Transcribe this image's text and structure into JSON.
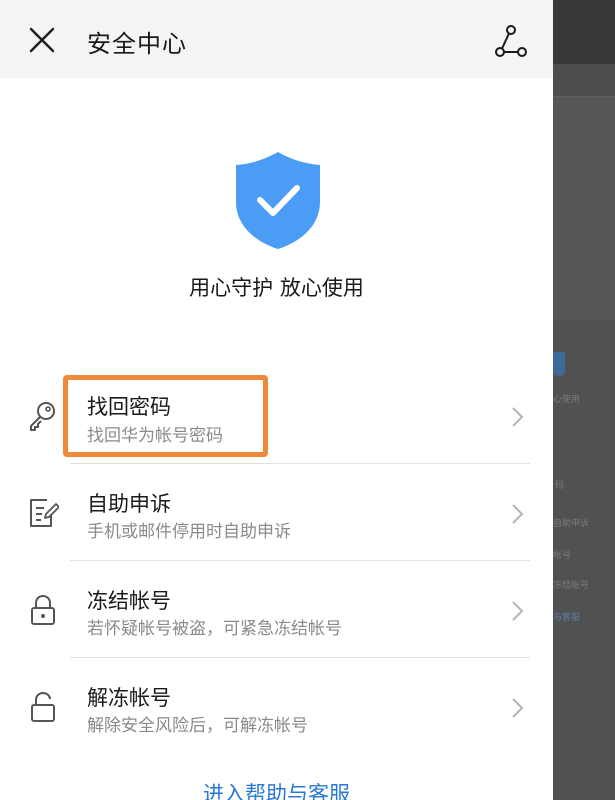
{
  "header": {
    "title": "安全中心",
    "close_icon": "close-icon",
    "share_icon": "share-icon"
  },
  "hero": {
    "shield_icon": "shield-check-icon",
    "shield_color": "#4a9cf5",
    "tagline": "用心守护 放心使用"
  },
  "menu": [
    {
      "icon": "key-icon",
      "title": "找回密码",
      "subtitle": "找回华为帐号密码",
      "highlighted": true
    },
    {
      "icon": "edit-note-icon",
      "title": "自助申诉",
      "subtitle": "手机或邮件停用时自助申诉"
    },
    {
      "icon": "lock-closed-icon",
      "title": "冻结帐号",
      "subtitle": "若怀疑帐号被盗，可紧急冻结帐号"
    },
    {
      "icon": "lock-open-icon",
      "title": "解冻帐号",
      "subtitle": "解除安全风险后，可解冻帐号"
    }
  ],
  "footer": {
    "help_link": "进入帮助与客服"
  },
  "colors": {
    "highlight": "#f0883a",
    "link": "#2878d6"
  },
  "background_page": {
    "fragment_1": "心使用",
    "fragment_2": "码",
    "fragment_3": "自助申诉",
    "fragment_4": "帐号",
    "fragment_5": "冻结帐号",
    "fragment_6": "与客服"
  }
}
